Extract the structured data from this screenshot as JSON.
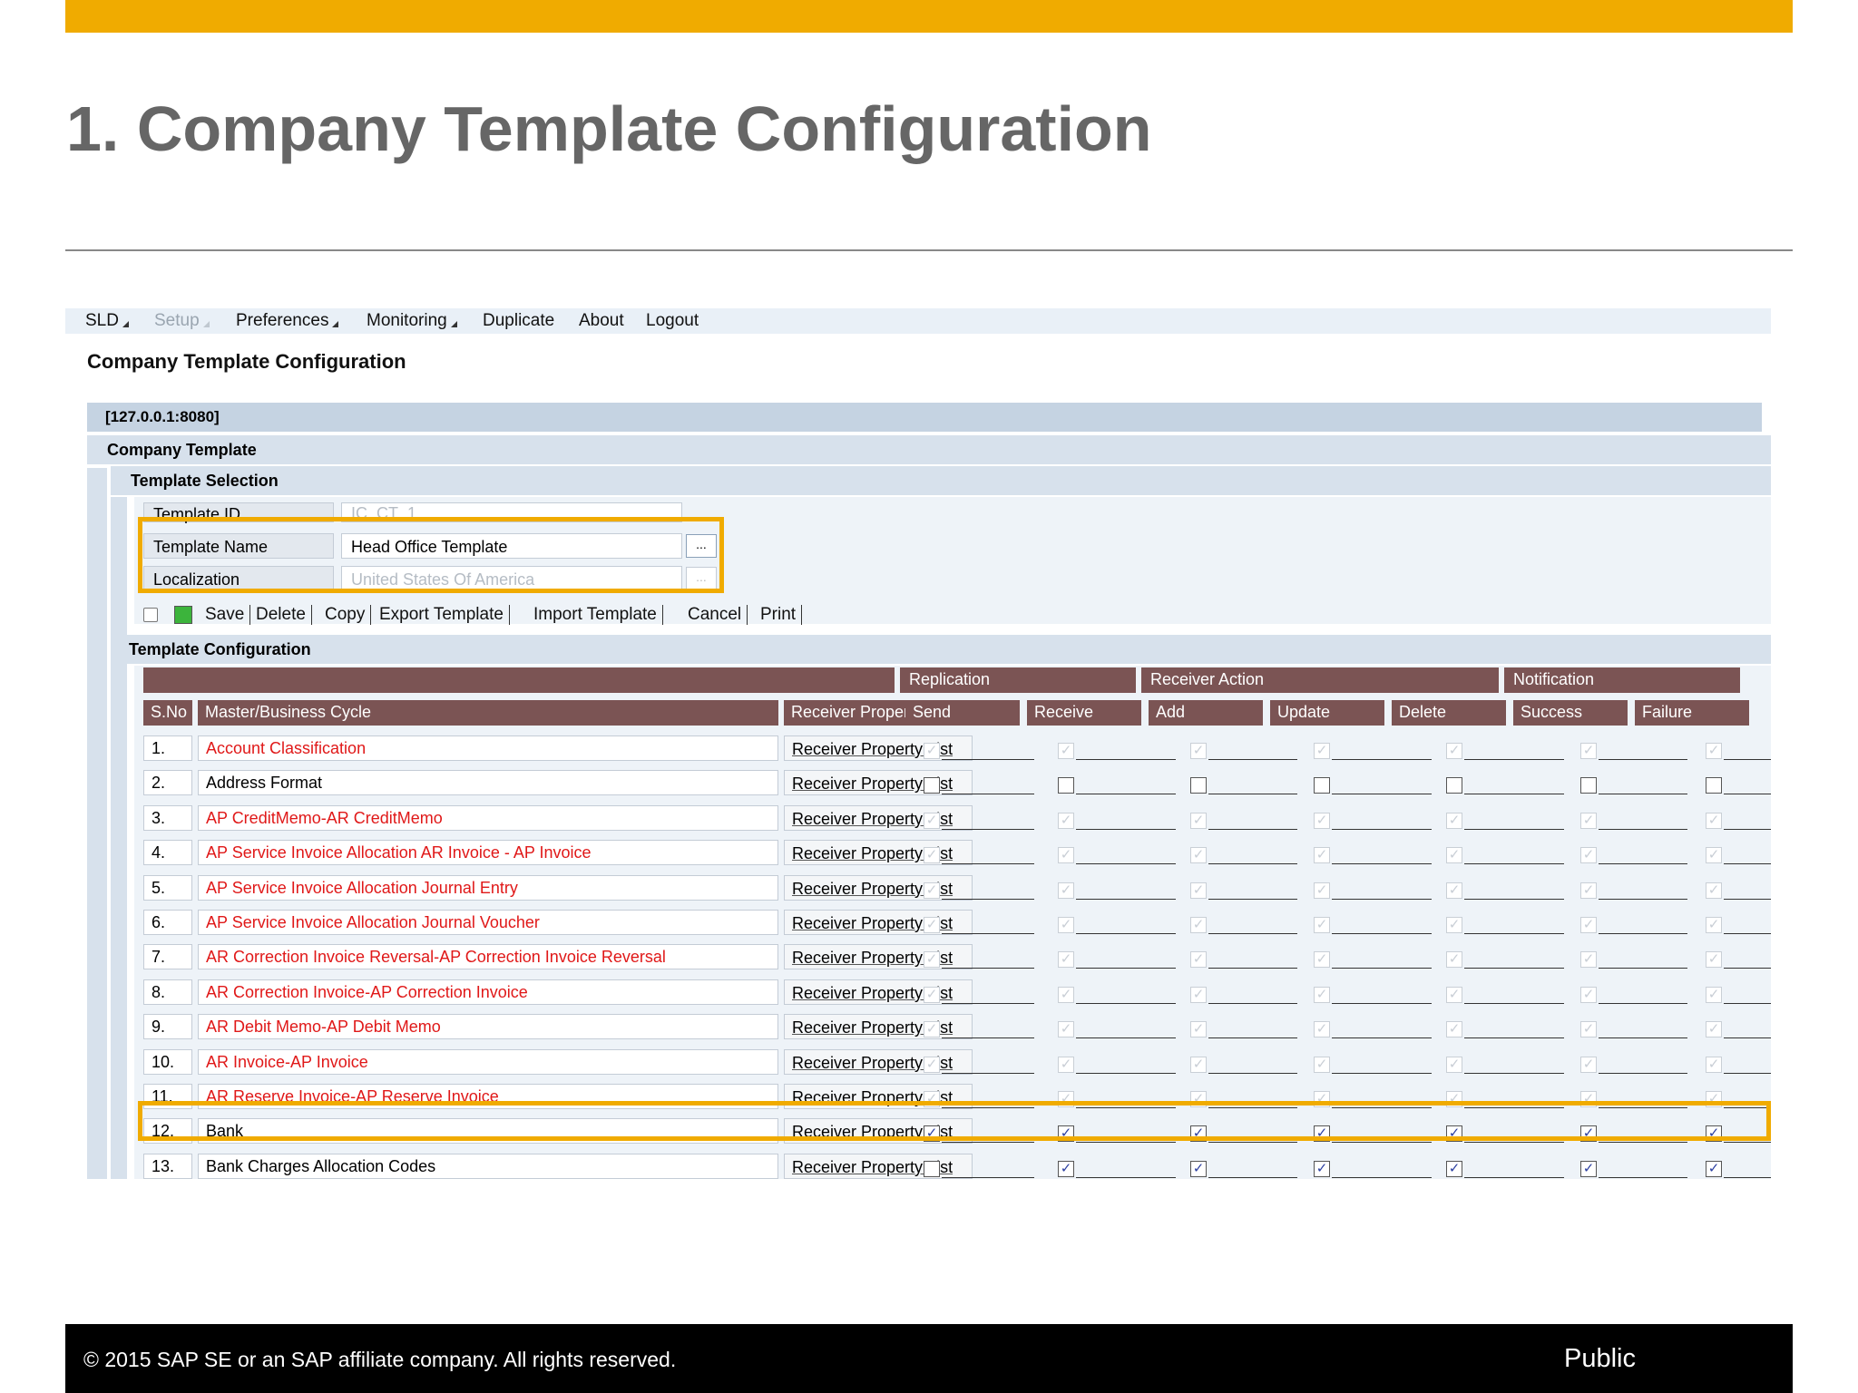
{
  "slide": {
    "title": "1. Company Template Configuration",
    "footer_copyright": "© 2015 SAP SE or an SAP affiliate company. All rights reserved.",
    "footer_classification": "Public",
    "colors": {
      "accent": "#f0ab00",
      "title_gray": "#666666"
    }
  },
  "menu": {
    "sld": "SLD",
    "setup": "Setup",
    "preferences": "Preferences",
    "monitoring": "Monitoring",
    "duplicate": "Duplicate",
    "about": "About",
    "logout": "Logout"
  },
  "page": {
    "heading": "Company Template Configuration",
    "server": "[127.0.0.1:8080]",
    "company_section": "Company Template",
    "selection_section": "Template Selection",
    "config_section": "Template Configuration"
  },
  "form": {
    "template_id_label": "Template ID",
    "template_id_value": "IC_CT_1",
    "template_name_label": "Template Name",
    "template_name_value": "Head Office Template",
    "localization_label": "Localization",
    "localization_value": "United States Of America",
    "lookup_button": "..."
  },
  "toolbar": {
    "save": "Save",
    "delete": "Delete",
    "copy": "Copy",
    "export": "Export Template",
    "import": "Import Template",
    "cancel": "Cancel",
    "print": "Print"
  },
  "grid": {
    "groups": {
      "replication": "Replication",
      "receiver_action": "Receiver Action",
      "notification": "Notification"
    },
    "headers": {
      "sno": "S.No",
      "cycle": "Master/Business Cycle",
      "rpl": "Receiver Property List",
      "send": "Send",
      "receive": "Receive",
      "add": "Add",
      "update": "Update",
      "delete": "Delete",
      "success": "Success",
      "failure": "Failure"
    },
    "rows": [
      {
        "sno": "1.",
        "name": "Account Classification",
        "link": "Receiver Property List",
        "red": true,
        "enabled": false,
        "checks": [
          true,
          true,
          true,
          true,
          true,
          true,
          true
        ]
      },
      {
        "sno": "2.",
        "name": "Address Format",
        "link": "Receiver Property List",
        "red": false,
        "enabled": true,
        "checks": [
          false,
          false,
          false,
          false,
          false,
          false,
          false
        ]
      },
      {
        "sno": "3.",
        "name": "AP CreditMemo-AR CreditMemo",
        "link": "Receiver Property List",
        "red": true,
        "enabled": false,
        "checks": [
          true,
          true,
          true,
          true,
          true,
          true,
          true
        ]
      },
      {
        "sno": "4.",
        "name": "AP Service Invoice Allocation AR Invoice - AP Invoice",
        "link": "Receiver Property List",
        "red": true,
        "enabled": false,
        "checks": [
          true,
          true,
          true,
          true,
          true,
          true,
          true
        ]
      },
      {
        "sno": "5.",
        "name": "AP Service Invoice Allocation Journal Entry",
        "link": "Receiver Property List",
        "red": true,
        "enabled": false,
        "checks": [
          true,
          true,
          true,
          true,
          true,
          true,
          true
        ]
      },
      {
        "sno": "6.",
        "name": "AP Service Invoice Allocation Journal Voucher",
        "link": "Receiver Property List",
        "red": true,
        "enabled": false,
        "checks": [
          true,
          true,
          true,
          true,
          true,
          true,
          true
        ]
      },
      {
        "sno": "7.",
        "name": "AR Correction Invoice Reversal-AP Correction Invoice Reversal",
        "link": "Receiver Property List",
        "red": true,
        "enabled": false,
        "checks": [
          true,
          true,
          true,
          true,
          true,
          true,
          true
        ]
      },
      {
        "sno": "8.",
        "name": "AR Correction Invoice-AP Correction Invoice",
        "link": "Receiver Property List",
        "red": true,
        "enabled": false,
        "checks": [
          true,
          true,
          true,
          true,
          true,
          true,
          true
        ]
      },
      {
        "sno": "9.",
        "name": "AR Debit Memo-AP Debit Memo",
        "link": "Receiver Property List",
        "red": true,
        "enabled": false,
        "checks": [
          true,
          true,
          true,
          true,
          true,
          true,
          true
        ]
      },
      {
        "sno": "10.",
        "name": "AR Invoice-AP Invoice",
        "link": "Receiver Property List",
        "red": true,
        "enabled": false,
        "checks": [
          true,
          true,
          true,
          true,
          true,
          true,
          true
        ]
      },
      {
        "sno": "11.",
        "name": "AR Reserve Invoice-AP Reserve Invoice",
        "link": "Receiver Property List",
        "red": true,
        "enabled": false,
        "checks": [
          true,
          true,
          true,
          true,
          true,
          true,
          true
        ]
      },
      {
        "sno": "12.",
        "name": "Bank",
        "link": "Receiver Property List",
        "red": false,
        "enabled": true,
        "checks": [
          true,
          true,
          true,
          true,
          true,
          true,
          true
        ]
      },
      {
        "sno": "13.",
        "name": "Bank Charges Allocation Codes",
        "link": "Receiver Property List",
        "red": false,
        "enabled": true,
        "checks": [
          false,
          true,
          true,
          true,
          true,
          true,
          true
        ]
      }
    ]
  }
}
